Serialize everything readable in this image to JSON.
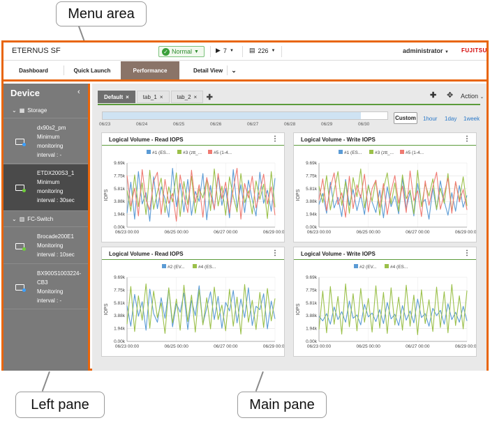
{
  "annotations": {
    "menu_area": "Menu area",
    "left_pane": "Left pane",
    "main_pane": "Main pane"
  },
  "header": {
    "app_title": "ETERNUS SF",
    "status_label": "Normal",
    "play_count": "7",
    "doc_count": "226",
    "user": "administrator",
    "logo": "FUJITSU"
  },
  "nav": {
    "tabs": [
      {
        "label": "Dashboard"
      },
      {
        "label": "Quick Launch"
      },
      {
        "label": "Performance"
      },
      {
        "label": "Detail View"
      }
    ],
    "active": "Performance"
  },
  "sidebar": {
    "title": "Device",
    "groups": [
      {
        "label": "Storage",
        "devices": [
          {
            "lines": [
              "dx90s2_pm",
              "Minimum",
              "monitoring",
              "interval : -"
            ]
          },
          {
            "lines": [
              "ETDX200S3_1",
              "Minimum",
              "monitoring",
              "interval : 30sec"
            ],
            "active": true
          }
        ]
      },
      {
        "label": "FC-Switch",
        "devices": [
          {
            "lines": [
              "Brocade200E1",
              "Monitoring",
              "interval : 10sec"
            ]
          },
          {
            "lines": [
              "BX900S1003224-",
              "CB3",
              "Monitoring",
              "interval : -"
            ]
          }
        ]
      }
    ]
  },
  "main": {
    "tabs": [
      {
        "label": "Default",
        "active": true
      },
      {
        "label": "tab_1"
      },
      {
        "label": "tab_2"
      }
    ],
    "action_label": "Action",
    "timeline_labels": [
      "06/23",
      "06/24",
      "06/25",
      "06/26",
      "06/27",
      "06/28",
      "06/29",
      "06/30"
    ],
    "range_buttons": {
      "custom": "Custom",
      "hour": "1hour",
      "day": "1day",
      "week": "1week"
    }
  },
  "colors": {
    "accent": "#e8650b",
    "series_blue": "#5b9bd5",
    "series_green": "#9bc04a",
    "series_red": "#ef7a72"
  },
  "chart_data": [
    {
      "type": "line",
      "title": "Logical Volume - Read IOPS",
      "ylabel": "IOPS",
      "yticks": [
        "9.69k",
        "7.75k",
        "5.81k",
        "3.88k",
        "1.94k",
        "0.00k"
      ],
      "ylim": [
        0,
        9690
      ],
      "xticks": [
        "06/23 00:00",
        "06/25 00:00",
        "06/27 00:00",
        "06/29 00:00"
      ],
      "legend": [
        "#1 (ES...",
        "#3 (ztt_...",
        "#5 (1-4..."
      ],
      "series": [
        {
          "name": "#1 (ES...",
          "color": "#5b9bd5",
          "values": [
            2100,
            6800,
            1200,
            8400,
            3500,
            5200,
            900,
            7600,
            2800,
            6100,
            4300,
            1500,
            8900,
            3100,
            6600,
            2300,
            7200,
            1800,
            5400,
            3900,
            8100,
            1100,
            6300,
            2600,
            7800,
            3300,
            5900,
            1400,
            8700,
            2900,
            6400,
            2200,
            7100,
            4100,
            1700,
            8300,
            3600,
            5600,
            2400,
            7400
          ]
        },
        {
          "name": "#3 (ztt_...",
          "color": "#9bc04a",
          "values": [
            5600,
            2400,
            7900,
            3100,
            6700,
            1900,
            8600,
            2700,
            5300,
            7400,
            2200,
            6100,
            3800,
            8200,
            1600,
            6900,
            3400,
            7700,
            2100,
            5800,
            4400,
            7300,
            2500,
            8800,
            3200,
            6200,
            1800,
            7600,
            4600,
            2300,
            8100,
            3700,
            5500,
            2000,
            7000,
            4200,
            6500,
            1300,
            8400,
            3000
          ]
        },
        {
          "name": "#5 (1-4...",
          "color": "#ef7a72",
          "values": [
            7800,
            3200,
            5900,
            1700,
            8700,
            4100,
            2600,
            6900,
            8300,
            1900,
            7200,
            3600,
            5100,
            900,
            7900,
            4800,
            2200,
            8600,
            3700,
            6400,
            1500,
            7500,
            5000,
            2700,
            8100,
            4300,
            6800,
            2100,
            5700,
            8900,
            1200,
            6600,
            4400,
            7700,
            2900,
            5300,
            8000,
            3500,
            6100,
            1800
          ]
        }
      ]
    },
    {
      "type": "line",
      "title": "Logical Volume - Write IOPS",
      "ylabel": "IOPS",
      "yticks": [
        "9.69k",
        "7.75k",
        "5.81k",
        "3.88k",
        "1.94k",
        "0.00k"
      ],
      "ylim": [
        0,
        9690
      ],
      "xticks": [
        "06/23 00:00",
        "06/25 00:00",
        "06/27 00:00",
        "06/29 00:00"
      ],
      "legend": [
        "#1 (ES...",
        "#3 (ztt_...",
        "#5 (1-4..."
      ],
      "series": [
        {
          "name": "#1 (ES...",
          "color": "#5b9bd5",
          "values": [
            3400,
            5100,
            2100,
            6800,
            2900,
            4500,
            1600,
            7200,
            3300,
            5700,
            2500,
            4900,
            1900,
            6400,
            3800,
            2200,
            5600,
            1400,
            6100,
            3100,
            4700,
            2000,
            7400,
            2800,
            5300,
            1700,
            6600,
            3500,
            4200,
            1200,
            5900,
            2600,
            7000,
            3900,
            1800,
            5200,
            2400,
            6300,
            3000,
            4800
          ]
        },
        {
          "name": "#3 (ztt_...",
          "color": "#9bc04a",
          "values": [
            6200,
            3700,
            7800,
            2600,
            5500,
            8400,
            3300,
            6900,
            2100,
            7500,
            4600,
            8800,
            2900,
            6300,
            3900,
            7100,
            1800,
            5800,
            8200,
            3500,
            6700,
            2400,
            7900,
            4300,
            5600,
            2000,
            8600,
            3100,
            6500,
            4700,
            7300,
            2700,
            5900,
            3600,
            8100,
            2300,
            6800,
            4100,
            7600,
            3200
          ]
        },
        {
          "name": "#5 (1-4...",
          "color": "#ef7a72",
          "values": [
            4100,
            7300,
            2500,
            6000,
            8200,
            3400,
            5200,
            1500,
            7700,
            2800,
            6400,
            4400,
            8000,
            2300,
            5800,
            7100,
            3000,
            6600,
            1900,
            5400,
            7800,
            3600,
            6200,
            2200,
            8500,
            4000,
            5500,
            1600,
            7000,
            3300,
            6100,
            8300,
            2700,
            5000,
            7400,
            2100,
            6900,
            3800,
            5700,
            2600
          ]
        }
      ]
    },
    {
      "type": "line",
      "title": "Logical Volume - Read IOPS",
      "ylabel": "IOPS",
      "yticks": [
        "9.69k",
        "7.75k",
        "5.81k",
        "3.88k",
        "1.94k",
        "0.00k"
      ],
      "ylim": [
        0,
        9690
      ],
      "xticks": [
        "06/23 00:00",
        "06/25 00:00",
        "06/27 00:00",
        "06/29 00:00"
      ],
      "legend": [
        "#2 (EV...",
        "#4 (ES..."
      ],
      "series": [
        {
          "name": "#2 (EV...",
          "color": "#5b9bd5",
          "values": [
            5400,
            2300,
            7100,
            3800,
            6000,
            1700,
            7900,
            4200,
            2900,
            6600,
            3500,
            8000,
            2200,
            5700,
            4400,
            7300,
            1800,
            6200,
            3900,
            8400,
            2600,
            5100,
            7500,
            3300,
            6800,
            2000,
            5900,
            4600,
            7700,
            2800,
            6400,
            3600,
            8100,
            2400,
            5300,
            4800,
            7200,
            1900,
            6100,
            3400
          ]
        },
        {
          "name": "#4 (ES...",
          "color": "#9bc04a",
          "values": [
            2600,
            8300,
            1500,
            6900,
            3200,
            8700,
            2000,
            7600,
            3600,
            5800,
            1200,
            8100,
            2800,
            6400,
            1700,
            8500,
            3000,
            7000,
            1400,
            7800,
            2500,
            6600,
            1900,
            8200,
            3300,
            5500,
            1600,
            7900,
            2300,
            6700,
            1100,
            8600,
            2900,
            6200,
            1800,
            7400,
            2100,
            8000,
            3100,
            6500
          ]
        }
      ]
    },
    {
      "type": "line",
      "title": "Logical Volume - Write IOPS",
      "ylabel": "IOPS",
      "yticks": [
        "9.69k",
        "7.75k",
        "5.81k",
        "3.88k",
        "1.94k",
        "0.00k"
      ],
      "ylim": [
        0,
        9690
      ],
      "xticks": [
        "06/23 00:00",
        "06/25 00:00",
        "06/27 00:00",
        "06/29 00:00"
      ],
      "legend": [
        "#2 (EV...",
        "#4 (ES..."
      ],
      "series": [
        {
          "name": "#2 (EV...",
          "color": "#5b9bd5",
          "values": [
            3800,
            3100,
            4200,
            2600,
            5200,
            3300,
            4500,
            2900,
            6100,
            3500,
            4000,
            2500,
            5600,
            3700,
            4300,
            3000,
            4800,
            2700,
            5900,
            3400,
            4100,
            2400,
            5400,
            3200,
            4600,
            2800,
            6400,
            3600,
            4200,
            2300,
            5000,
            3900,
            4700,
            2600,
            5700,
            3300,
            4400,
            2900,
            5300,
            3100
          ]
        },
        {
          "name": "#4 (ES...",
          "color": "#9bc04a",
          "values": [
            1800,
            7600,
            1300,
            8300,
            2600,
            6800,
            1100,
            8700,
            2200,
            7200,
            1600,
            8000,
            2900,
            6500,
            1400,
            8400,
            2000,
            7400,
            1200,
            8100,
            2500,
            6700,
            1700,
            8500,
            2300,
            7000,
            1000,
            7800,
            2700,
            6300,
            1500,
            8200,
            2100,
            7500,
            1300,
            8600,
            2400,
            6900,
            1900,
            7700
          ]
        }
      ]
    }
  ]
}
